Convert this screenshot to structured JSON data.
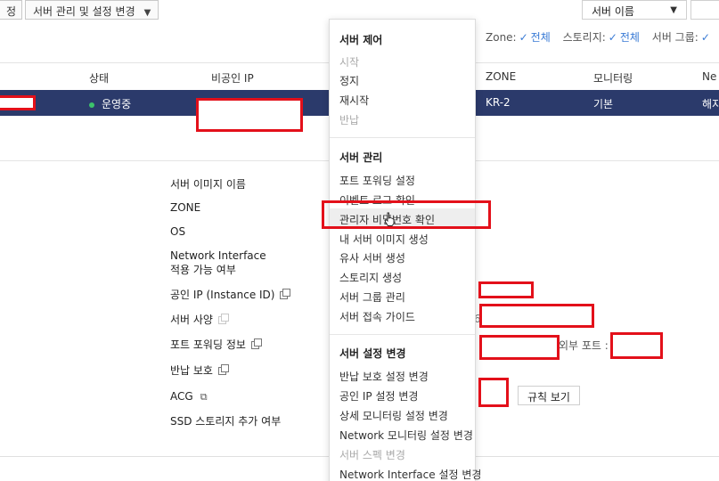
{
  "toolbar": {
    "left_partial": "정",
    "server_manage_button": "서버 관리 및 설정 변경",
    "filter_select": "서버 이름"
  },
  "filters": {
    "zone_label": "Zone:",
    "zone_value": "전체",
    "storage_label": "스토리지:",
    "storage_value": "전체",
    "group_label": "서버 그룹:"
  },
  "table": {
    "headers": {
      "status": "상태",
      "private_ip": "비공인 IP",
      "zone": "ZONE",
      "monitoring": "모니터링",
      "ne_partial": "Ne"
    },
    "row": {
      "status": "운영중",
      "zone": "KR-2",
      "monitoring": "기본",
      "cut_partial": "해지"
    }
  },
  "details": {
    "image_name": "서버 이미지 이름",
    "zone": "ZONE",
    "os": "OS",
    "network_interface_1": "Network Interface",
    "network_interface_2": "적용 가능 여부",
    "public_ip": "공인 IP (Instance ID)",
    "server_spec": "서버 사양",
    "port_forwarding": "포트 포워딩 정보",
    "return_protect": "반납 보호",
    "acg": "ACG",
    "ssd_storage": "SSD 스토리지 추가 여부",
    "external_port": "외부 포트 :",
    "rule_view_button": "규칙 보기",
    "digit_6": "6"
  },
  "menu": {
    "section_control": "서버 제어",
    "start": "시작",
    "stop": "정지",
    "restart": "재시작",
    "return": "반납",
    "section_manage": "서버 관리",
    "port_forwarding_setting": "포트 포워딩 설정",
    "event_log": "이벤트 로그 확인",
    "admin_password": "관리자 비밀번호 확인",
    "create_image": "내 서버 이미지 생성",
    "create_similar": "유사 서버 생성",
    "create_storage": "스토리지 생성",
    "group_manage": "서버 그룹 관리",
    "connect_guide": "서버 접속 가이드",
    "section_change": "서버 설정 변경",
    "return_protect_change": "반납 보호 설정 변경",
    "public_ip_change": "공인 IP 설정 변경",
    "detail_monitoring_change": "상세 모니터링 설정 변경",
    "network_monitoring_change": "Network 모니터링 설정 변경",
    "spec_change": "서버 스펙 변경",
    "network_interface_change": "Network Interface 설정 변경"
  },
  "colors": {
    "selected_row": "#2b3a6b",
    "annotation_red": "#e3101a",
    "status_green": "#3cc36b",
    "filter_blue": "#3a7bd5"
  }
}
